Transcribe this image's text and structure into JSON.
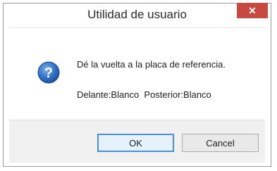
{
  "window": {
    "title": "Utilidad de usuario",
    "close_symbol": "✕"
  },
  "message": {
    "line1": "Dé la vuelta a la placa de referencia.",
    "line2": "Delante:Blanco  Posterior:Blanco",
    "icon": "question-icon"
  },
  "buttons": {
    "ok_label": "OK",
    "cancel_label": "Cancel"
  },
  "colors": {
    "close_bg": "#c74a41",
    "icon_blue": "#2f6fc4",
    "footer_bg": "#f0f0f0",
    "ok_border": "#4a90d9"
  }
}
